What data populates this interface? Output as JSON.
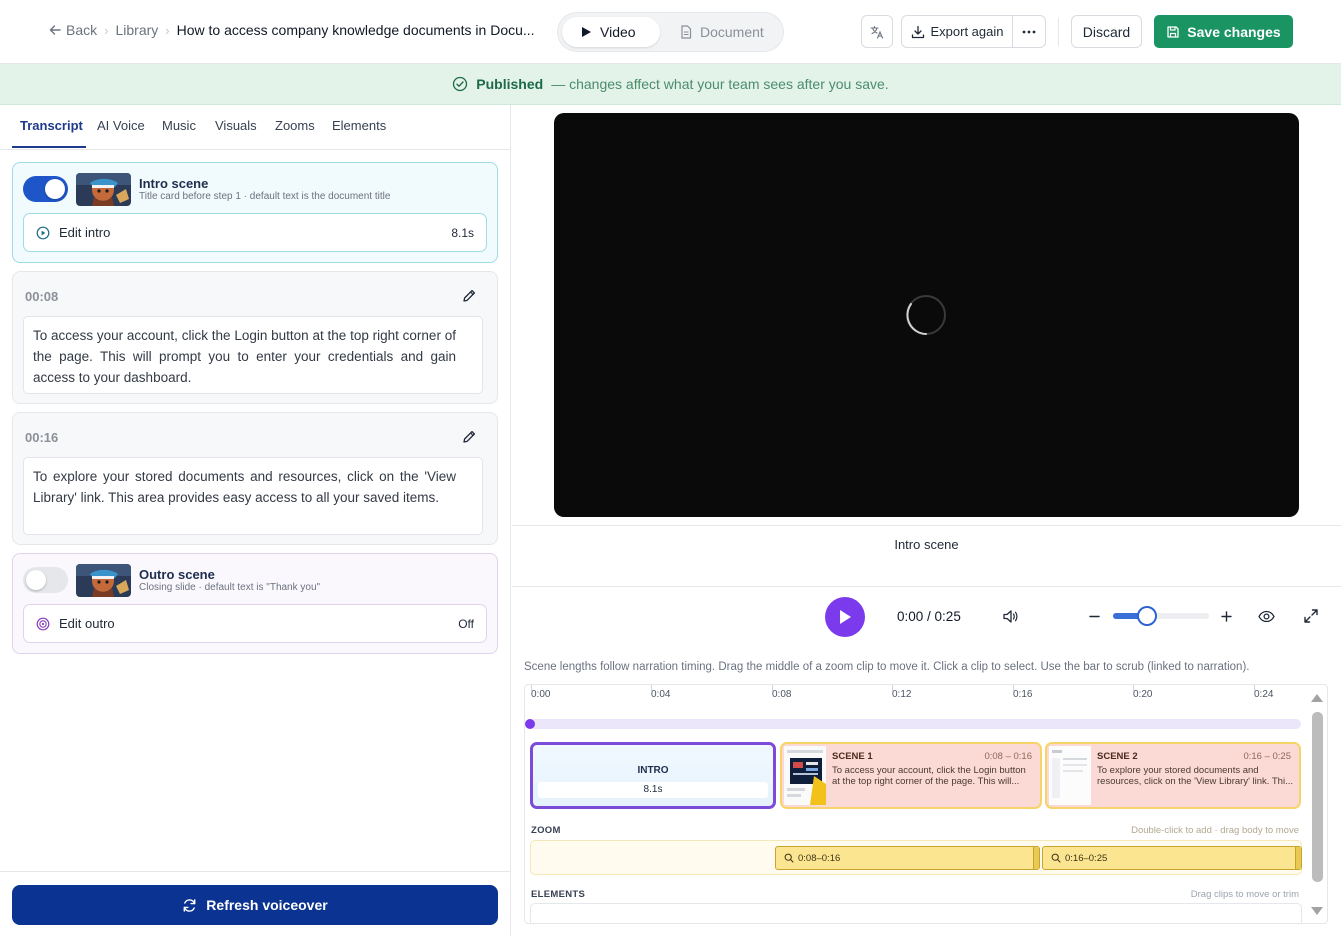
{
  "header": {
    "back_label": "Back",
    "breadcrumb_library": "Library",
    "breadcrumb_current": "How to access company knowledge documents in Docu...",
    "mode_tabs": [
      {
        "label": "Video",
        "active": true
      },
      {
        "label": "Document",
        "active": false
      }
    ],
    "export_label": "Export again",
    "discard_label": "Discard",
    "save_label": "Save changes"
  },
  "banner": {
    "status": "Published",
    "message": "— changes affect what your team sees after you save."
  },
  "left_tabs": [
    "Transcript",
    "AI Voice",
    "Music",
    "Visuals",
    "Zooms",
    "Elements"
  ],
  "intro": {
    "enabled": true,
    "title": "Intro scene",
    "subtitle": "Title card before step 1 · default text is the document title",
    "edit_label": "Edit intro",
    "duration": "8.1s"
  },
  "steps": [
    {
      "time": "00:08",
      "text": "To access your account, click the Login button at the top right corner of the page. This will prompt you to enter your credentials and gain access to your dashboard."
    },
    {
      "time": "00:16",
      "text": "To explore your stored documents and resources, click on the 'View Library' link. This area provides easy access to all your saved items."
    }
  ],
  "outro": {
    "enabled": false,
    "title": "Outro scene",
    "subtitle": "Closing slide · default text is \"Thank you\"",
    "edit_label": "Edit outro",
    "status": "Off"
  },
  "refresh_label": "Refresh voiceover",
  "player": {
    "current_scene": "Intro scene",
    "current_time": "0:00",
    "total_time": "0:25",
    "zoom_level": 0.35
  },
  "timeline": {
    "hint": "Scene lengths follow narration timing. Drag the middle of a zoom clip to move it. Click a clip to select. Use the bar to scrub (linked to narration).",
    "ticks": [
      "0:00",
      "0:04",
      "0:08",
      "0:12",
      "0:16",
      "0:20",
      "0:24"
    ],
    "intro_clip": {
      "label": "INTRO",
      "duration": "8.1s"
    },
    "scene_clips": [
      {
        "name": "SCENE 1",
        "range": "0:08 – 0:16",
        "text": "To access your account, click the Login button at the top right corner of the page. This will..."
      },
      {
        "name": "SCENE 2",
        "range": "0:16 – 0:25",
        "text": "To explore your stored documents and resources, click on the 'View Library' link. Thi..."
      }
    ],
    "zoom_lane": {
      "label": "ZOOM",
      "hint": "Double-click to add · drag body to move"
    },
    "zoom_clips": [
      "0:08–0:16",
      "0:16–0:25"
    ],
    "elements_lane": {
      "label": "ELEMENTS",
      "hint": "Drag clips to move or trim"
    }
  },
  "colors": {
    "primary_navy": "#0b3391",
    "save_green": "#1a9463",
    "accent_purple": "#7c3aed",
    "banner_green": "#e3f3e9"
  }
}
